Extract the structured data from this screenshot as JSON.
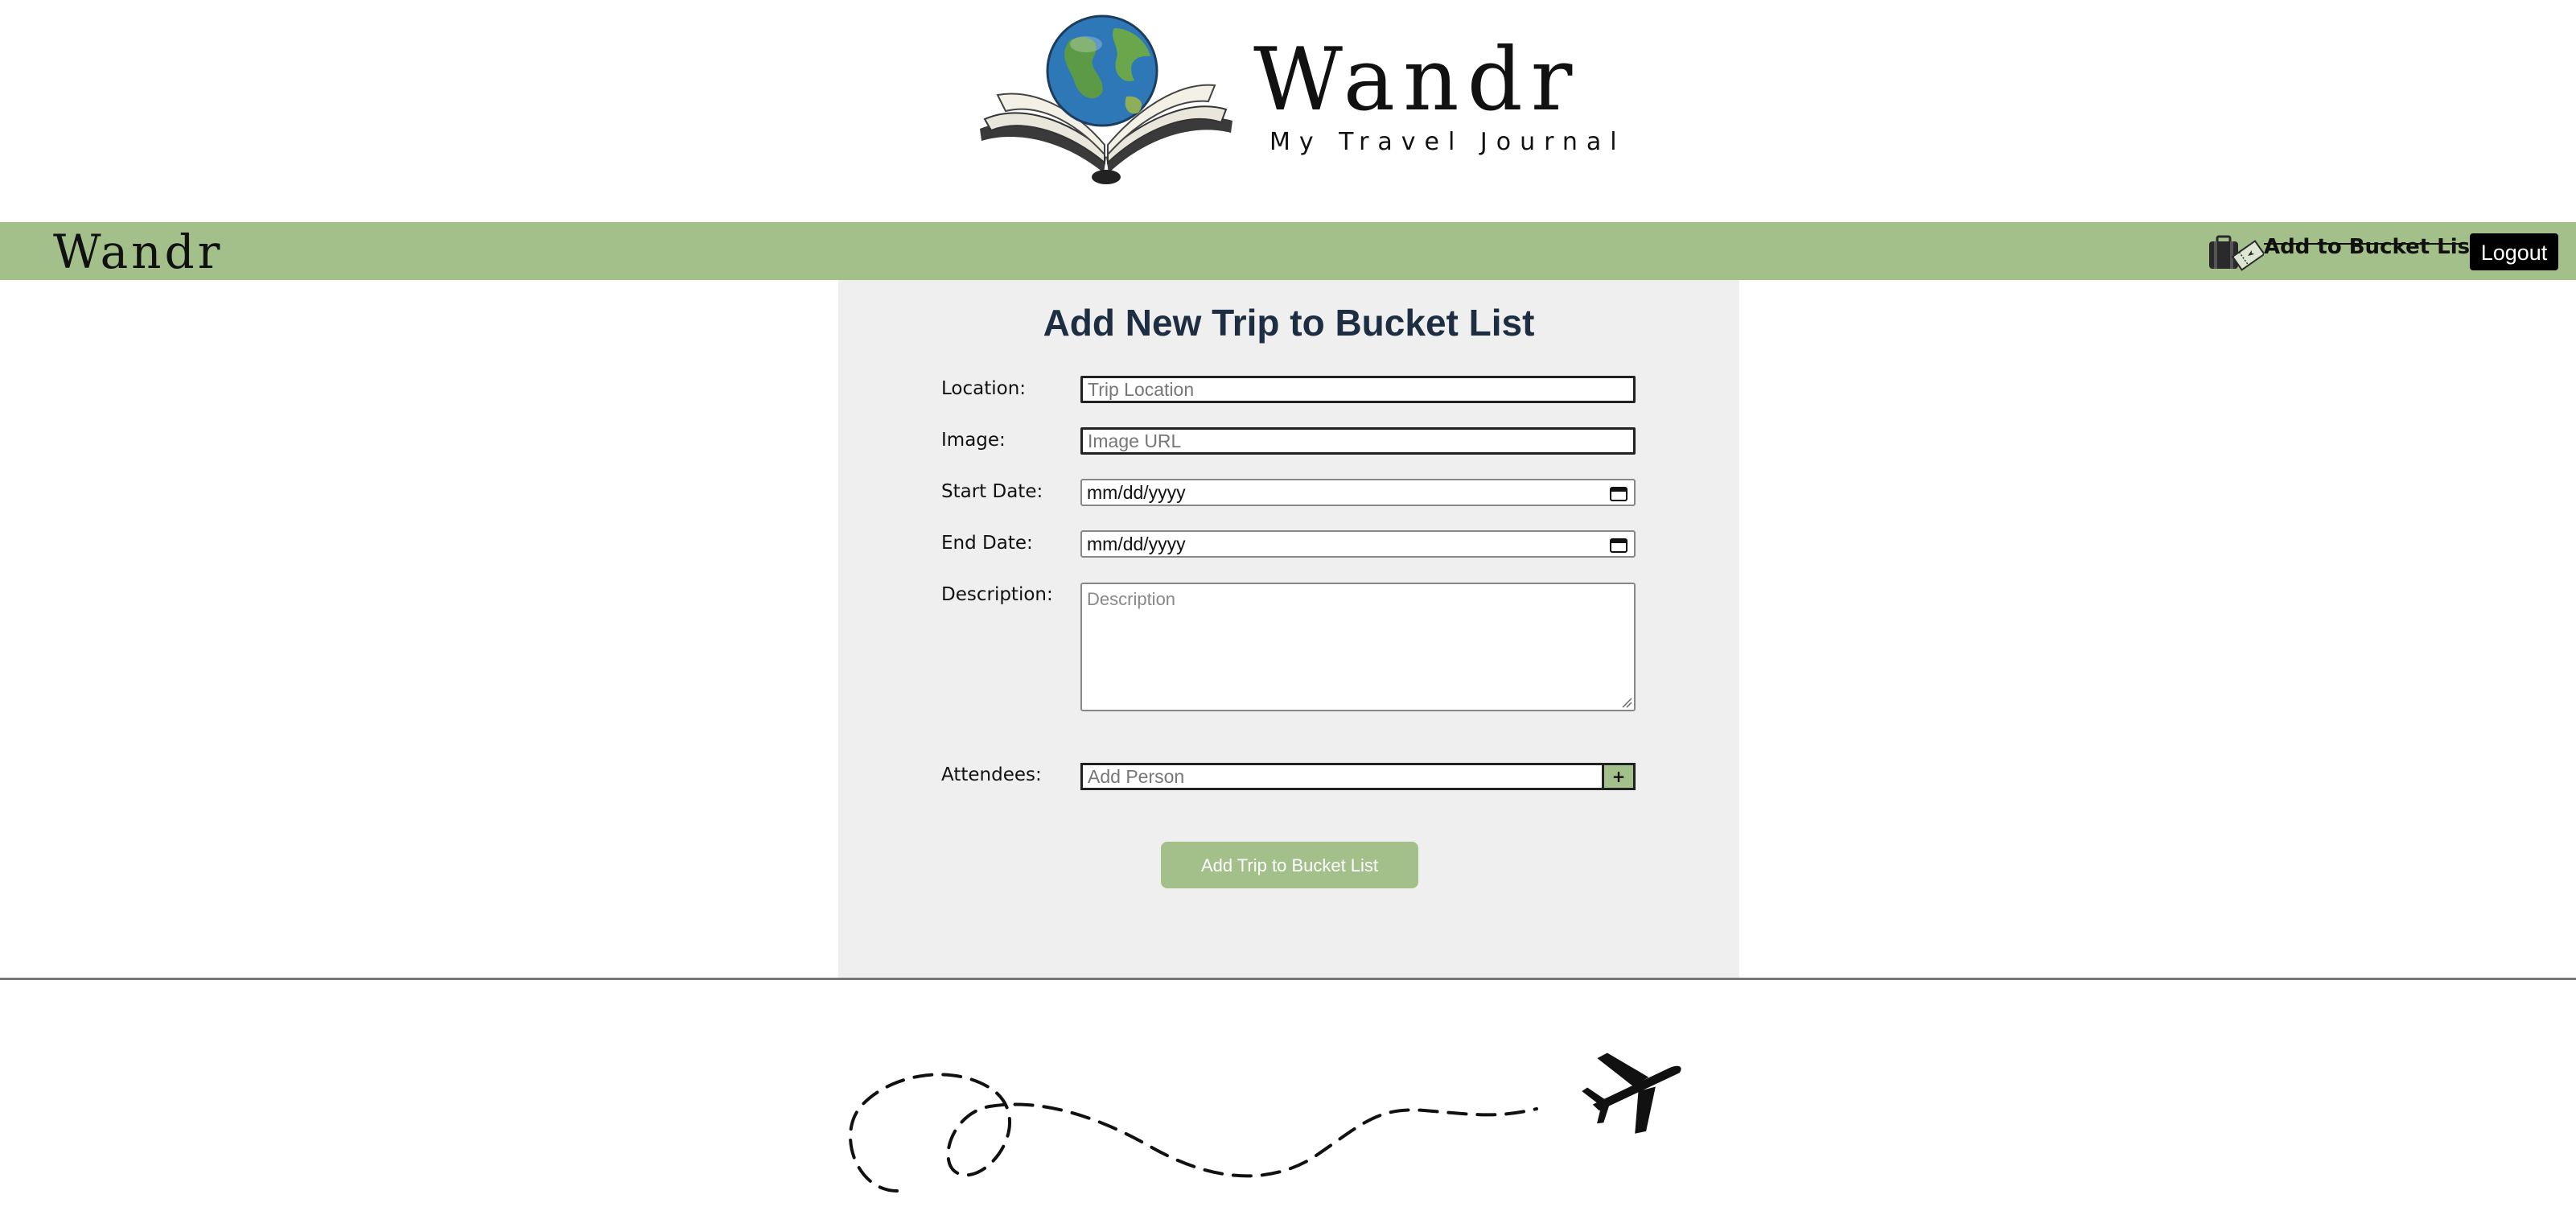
{
  "logo": {
    "title": "Wandr",
    "subtitle": "My Travel Journal",
    "image_icon": "globe-on-open-book-icon"
  },
  "navbar": {
    "brand": "Wandr",
    "add_link_icon": "suitcase-ticket-icon",
    "add_link_label": "Add to Bucket List",
    "logout_label": "Logout",
    "bg_color": "#a3c08b"
  },
  "form": {
    "title": "Add New Trip to Bucket List",
    "location_label": "Location:",
    "location_placeholder": "Trip Location",
    "image_label": "Image:",
    "image_placeholder": "Image URL",
    "start_date_label": "Start Date:",
    "start_date_value": "mm/dd/yyyy",
    "end_date_label": "End Date:",
    "end_date_value": "mm/dd/yyyy",
    "description_label": "Description:",
    "description_placeholder": "Description",
    "attendees_label": "Attendees:",
    "attendees_placeholder": "Add Person",
    "add_person_label": "+",
    "submit_label": "Add Trip to Bucket List"
  },
  "footer": {
    "art_icon": "dashed-flight-path-airplane-icon"
  },
  "colors": {
    "accent_green": "#a3c08b",
    "title_navy": "#1e2e42",
    "card_bg": "#efefef"
  }
}
